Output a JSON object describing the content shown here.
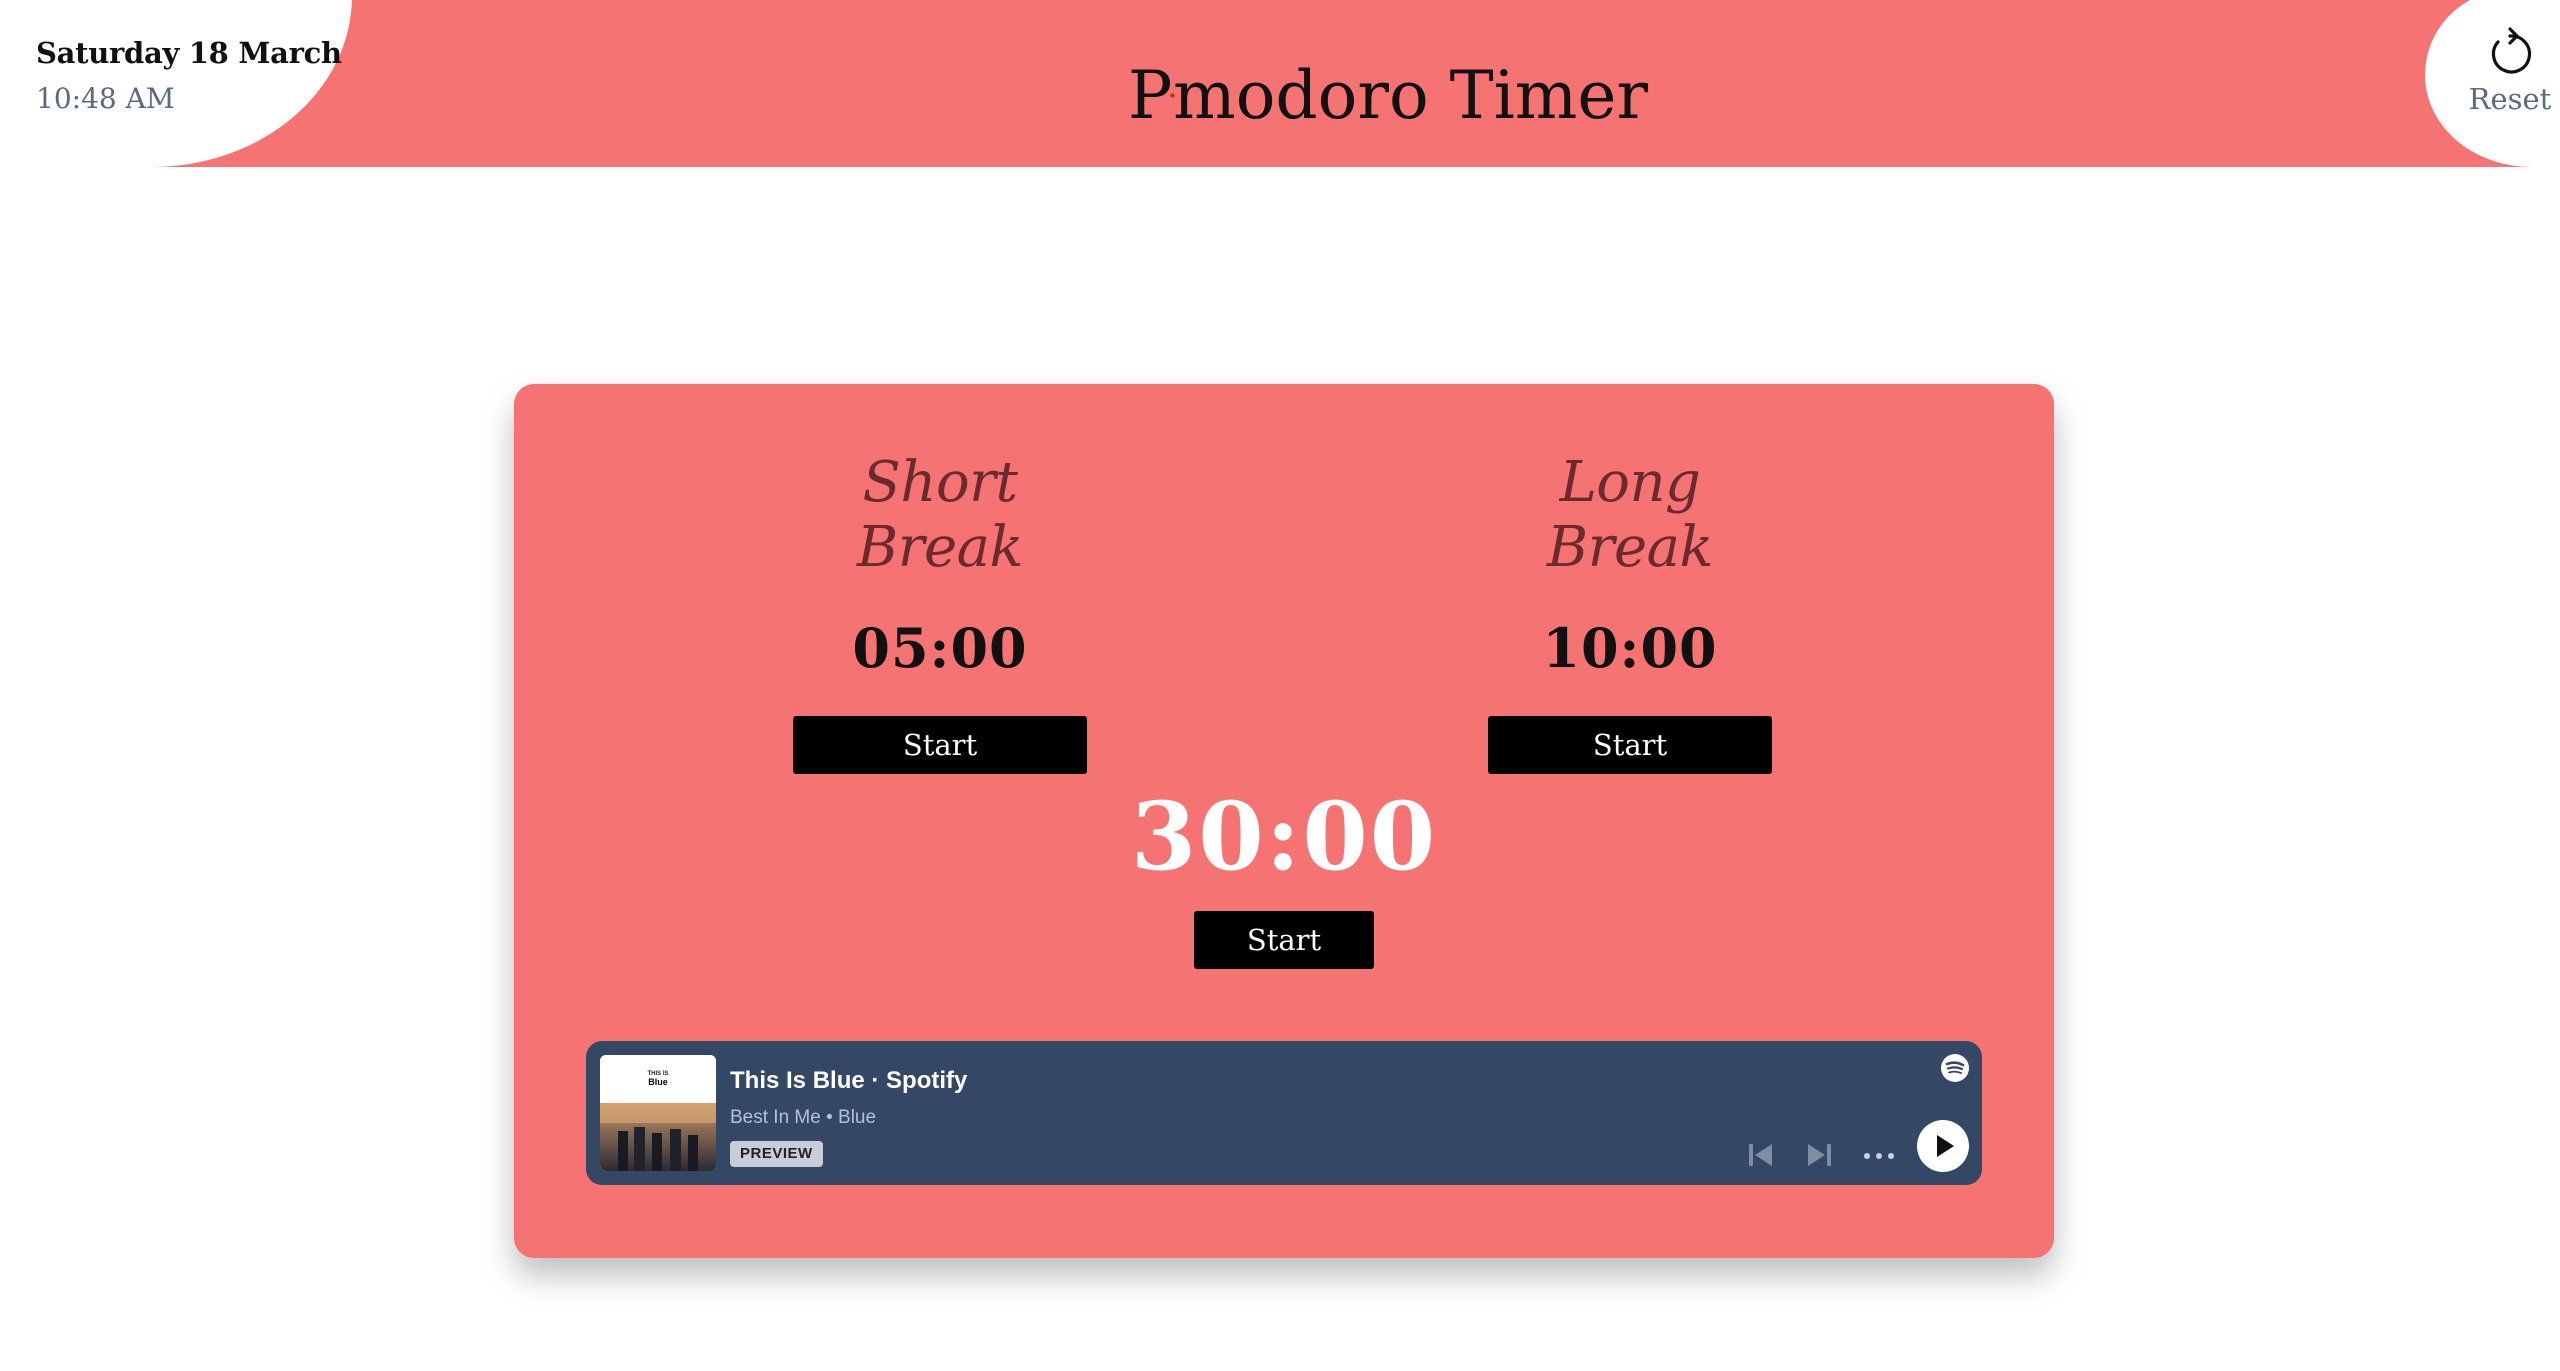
{
  "header": {
    "date": "Saturday 18 March",
    "time": "10:48 AM",
    "title_prefix": "P",
    "title_suffix": "modoro Timer",
    "reset_label": "Reset",
    "background": "#f67373"
  },
  "timers": {
    "short_break": {
      "title": "Short Break",
      "time": "05:00",
      "button": "Start"
    },
    "long_break": {
      "title": "Long Break",
      "time": "10:00",
      "button": "Start"
    },
    "pomodoro": {
      "time": "30:00",
      "button": "Start"
    }
  },
  "spotify": {
    "title": "This Is Blue · Spotify",
    "subtitle": "Best In Me • Blue",
    "badge": "PREVIEW",
    "cover_small": "THIS IS",
    "cover_big": "Blue",
    "background": "#344866"
  }
}
